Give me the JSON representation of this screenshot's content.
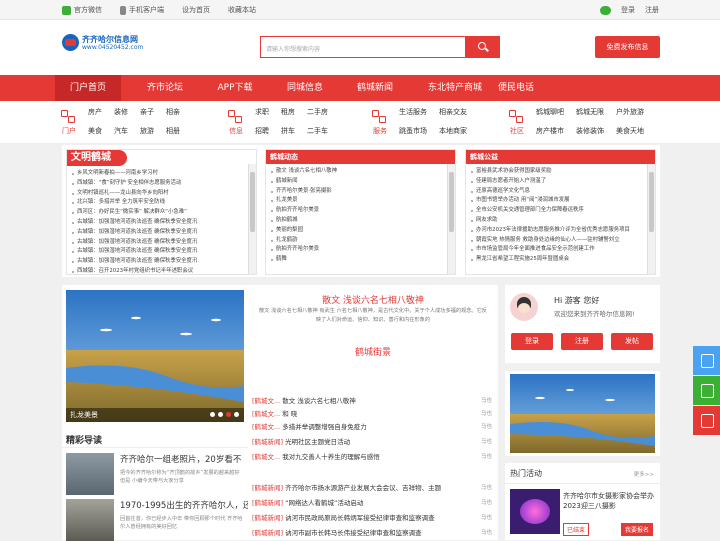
{
  "topbar": {
    "links": [
      "官方微信",
      "手机客户端",
      "设为首页",
      "收藏本站"
    ],
    "login": "登录",
    "register": "注册"
  },
  "logo": {
    "name": "齐齐哈尔信息网",
    "url": "www.04520452.com"
  },
  "search": {
    "placeholder": "请输入你想搜索内容"
  },
  "publish_button": "免费发布信息",
  "nav": [
    "门户首页",
    "齐市论坛",
    "APP下载",
    "同城信息",
    "鹤城新闻",
    "东北特产商城",
    "便民电话"
  ],
  "categories": [
    {
      "label": "门户",
      "links": [
        "房产",
        "装修",
        "亲子",
        "相亲",
        "美食",
        "汽车",
        "旅游",
        "相册"
      ]
    },
    {
      "label": "信息",
      "links": [
        "求职",
        "租房",
        "二手房",
        "招聘",
        "拼车",
        "二手车"
      ]
    },
    {
      "label": "服务",
      "links": [
        "生活服务",
        "相亲交友",
        "跳蚤市场",
        "本地商家"
      ]
    },
    {
      "label": "社区",
      "links": [
        "鹤城聊吧",
        "鹤城无限",
        "户外旅游",
        "房产楼市",
        "装修装饰",
        "美食天地"
      ]
    }
  ],
  "col1": {
    "title": "文明鹤城",
    "items": [
      "乡风文明新春拍——河南乡学习村",
      "西城镇：“食”刻守护 安全相伴志愿服务活动",
      "文明村镇巡礼——龙山县向华乡向阳村",
      "北兴镇：多措并举 全力筑牢安全防线",
      "西河区：办好民生“微实事” 解决群众“小急难”",
      "古城镇：加强湿地河道执法巡查 确保秋季安全度汛",
      "古城镇：加强湿地河道执法巡查 确保秋季安全度汛",
      "古城镇：加强湿地河道执法巡查 确保秋季安全度汛",
      "古城镇：加强湿地河道执法巡查 确保秋季安全度汛",
      "古城镇：加强湿地河道执法巡查 确保秋季安全度汛",
      "西城镇：召开2023年村党组织书记半年述职会议"
    ]
  },
  "col2": {
    "title": "鹤城动态",
    "items": [
      "散文 浅谈六名七相八敬神",
      "鹤城新闻",
      "齐齐哈尔美景·张亮摄影",
      "扎龙美景",
      "航拍齐齐哈尔美景",
      "航拍鹤城",
      "美丽的梨园",
      "扎龙鹤韵",
      "航拍齐齐哈尔美景",
      "鹤舞"
    ]
  },
  "col3": {
    "title": "鹤城公益",
    "items": [
      "富裕县武术协会获得国家级奖励",
      "佳建局志愿者开始入户测温了",
      "还原高德巡学文化气息",
      "市图书馆举办活动 用“阅”浸润城市发展",
      "全市公安机关交通管理部门全力保障春运秩序",
      "网友求助",
      "办河市2023年法律援助志愿服务推介评为全省优秀志愿服务项目",
      "朝霞实地 热情服务 救助身处边缘的仙心人——驻村辅警刘立",
      "市市场监管局今年全面推进食品安全示范创建工作",
      "黑龙江省希望工程实施25周年暨圆桌会"
    ]
  },
  "slide": {
    "caption": "扎龙美景",
    "dot_count": 4,
    "active_dot": 2
  },
  "jingcai": {
    "title": "精彩导读",
    "news": [
      {
        "title": "齐齐哈尔一组老照片，20岁看不",
        "desc": "把今的齐齐哈尔称为“齐顶鹤的故乡”发展的越来越好 但是 小编今天带与大家分享"
      },
      {
        "title": "1970-1995出生的齐齐哈尔人，还",
        "desc": "回首往昔，你已经步入中年 带你回顾那个时代 齐齐哈尔人曾经拥有的美好回忆"
      }
    ]
  },
  "middle": {
    "headline": "散文 浅谈六名七相八敬神",
    "summary": "散文 浅谈六名七相八敬神 有武生 六名七相八敬神，是古代文化中。关于个人成功多福的观念。它反映了人们对命运、信仰、知识、善行和内在形象的",
    "sub_headline": "鹤城街景",
    "list": [
      {
        "cat": "[鹤城文...",
        "title": "散文 浅谈六名七相八敬神",
        "tag": "马也"
      },
      {
        "cat": "[鹤城文...",
        "title": "和  晓",
        "tag": "马也"
      },
      {
        "cat": "[鹤城文...",
        "title": "多措并举调整增强自身免疫力",
        "tag": "马也"
      },
      {
        "cat": "[鹤城新闻]",
        "title": "光明社区主题党日活动",
        "tag": "马也"
      },
      {
        "cat": "[鹤城文...",
        "title": "我对九交善人十养生的理解与感悟",
        "tag": "马也"
      },
      {
        "cat": "[鹤城新闻]",
        "title": "齐齐哈尔市扬水源游产业发展大会会议、吉祥物、主题",
        "tag": "马也"
      },
      {
        "cat": "[鹤城新闻]",
        "title": "“网络达人看鹤城”活动启动",
        "tag": "马也"
      },
      {
        "cat": "[鹤城新闻]",
        "title": "讷河市民政局原局长韩炳军接受纪律审查和监察调查",
        "tag": "马也"
      },
      {
        "cat": "[鹤城新闻]",
        "title": "讷河市副市长韩马长伟接受纪律审查和监察调查",
        "tag": "马也"
      }
    ]
  },
  "user": {
    "greeting": "Hi 游客 您好",
    "welcome": "欢迎您来到齐齐哈尔信息网!",
    "buttons": [
      "登录",
      "注册",
      "发帖"
    ]
  },
  "hot": {
    "title": "热门活动",
    "more": "更多>>",
    "item_title": "齐齐哈尔市女摄影家协会举办2023迎三八摄影",
    "tag_status": "已结束",
    "tag_action": "我要报名"
  },
  "colors": {
    "accent": "#e53935",
    "dark_accent": "#c62828",
    "wechat": "#3cb034"
  }
}
